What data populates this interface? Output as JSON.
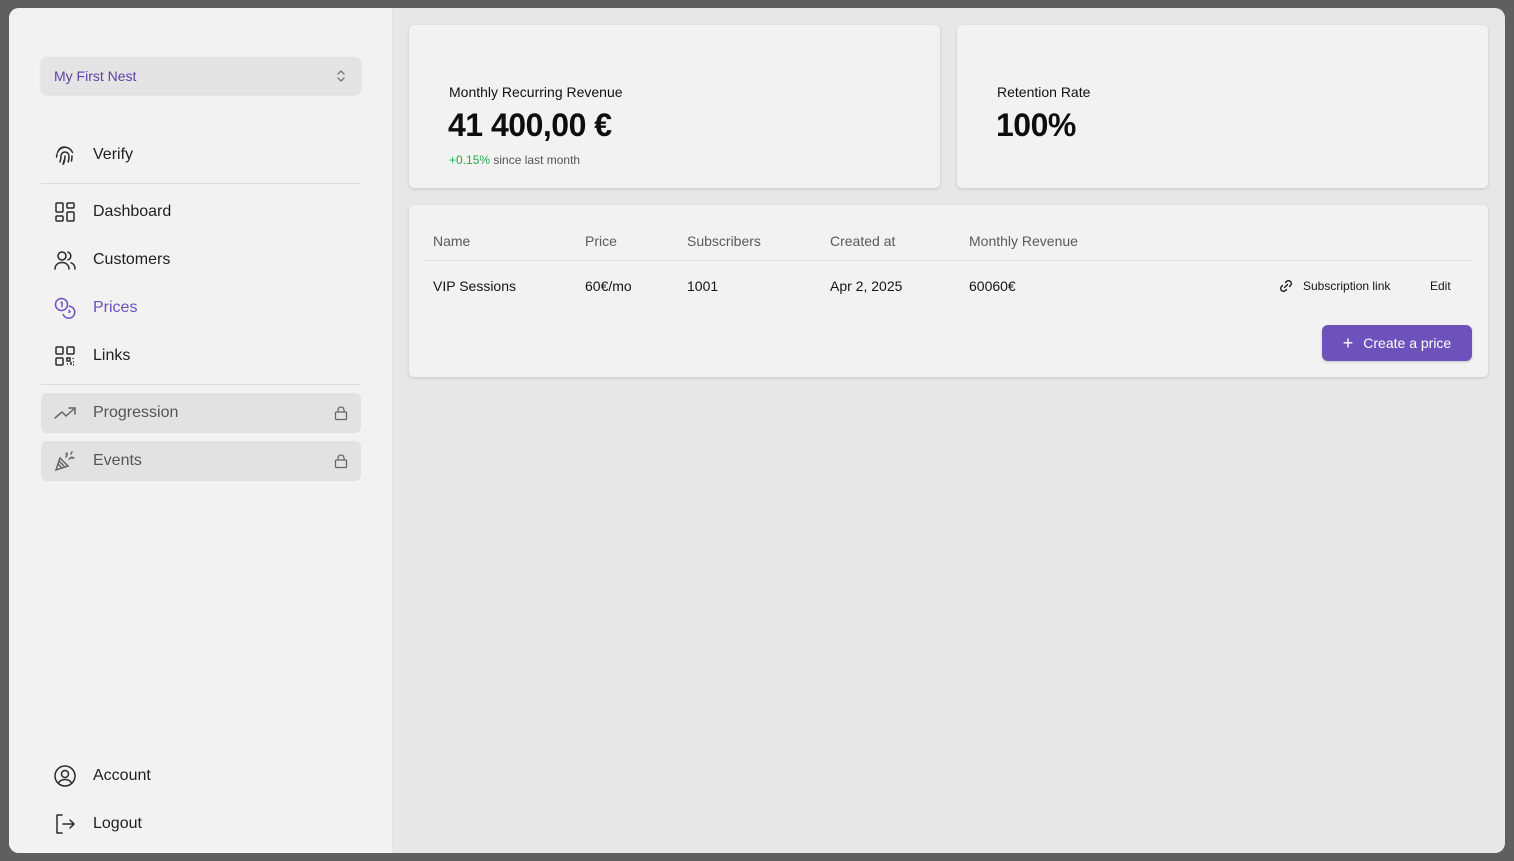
{
  "sidebar": {
    "nest_selector": {
      "label": "My First Nest"
    },
    "items": [
      {
        "label": "Verify",
        "icon": "fingerprint-icon"
      },
      {
        "label": "Dashboard",
        "icon": "dashboard-grid-icon"
      },
      {
        "label": "Customers",
        "icon": "users-icon"
      },
      {
        "label": "Prices",
        "icon": "coins-icon",
        "active": true
      },
      {
        "label": "Links",
        "icon": "qr-code-icon"
      },
      {
        "label": "Progression",
        "icon": "trending-up-icon",
        "locked": true
      },
      {
        "label": "Events",
        "icon": "party-popper-icon",
        "locked": true
      }
    ],
    "footer": [
      {
        "label": "Account",
        "icon": "user-circle-icon"
      },
      {
        "label": "Logout",
        "icon": "logout-icon"
      }
    ]
  },
  "stats": {
    "mrr": {
      "title": "Monthly Recurring Revenue",
      "value": "41 400,00 €",
      "delta": "+0.15%",
      "delta_suffix": "since last month"
    },
    "retention": {
      "title": "Retention Rate",
      "value": "100%"
    }
  },
  "prices_table": {
    "columns": [
      "Name",
      "Price",
      "Subscribers",
      "Created at",
      "Monthly Revenue"
    ],
    "rows": [
      {
        "name": "VIP Sessions",
        "price": "60€/mo",
        "subscribers": "1001",
        "created_at": "Apr 2, 2025",
        "monthly_revenue": "60060€",
        "link_label": "Subscription link",
        "edit_label": "Edit"
      }
    ],
    "create_button": "Create a price"
  },
  "colors": {
    "accent": "#6e52bb",
    "positive": "#1fae4b"
  }
}
